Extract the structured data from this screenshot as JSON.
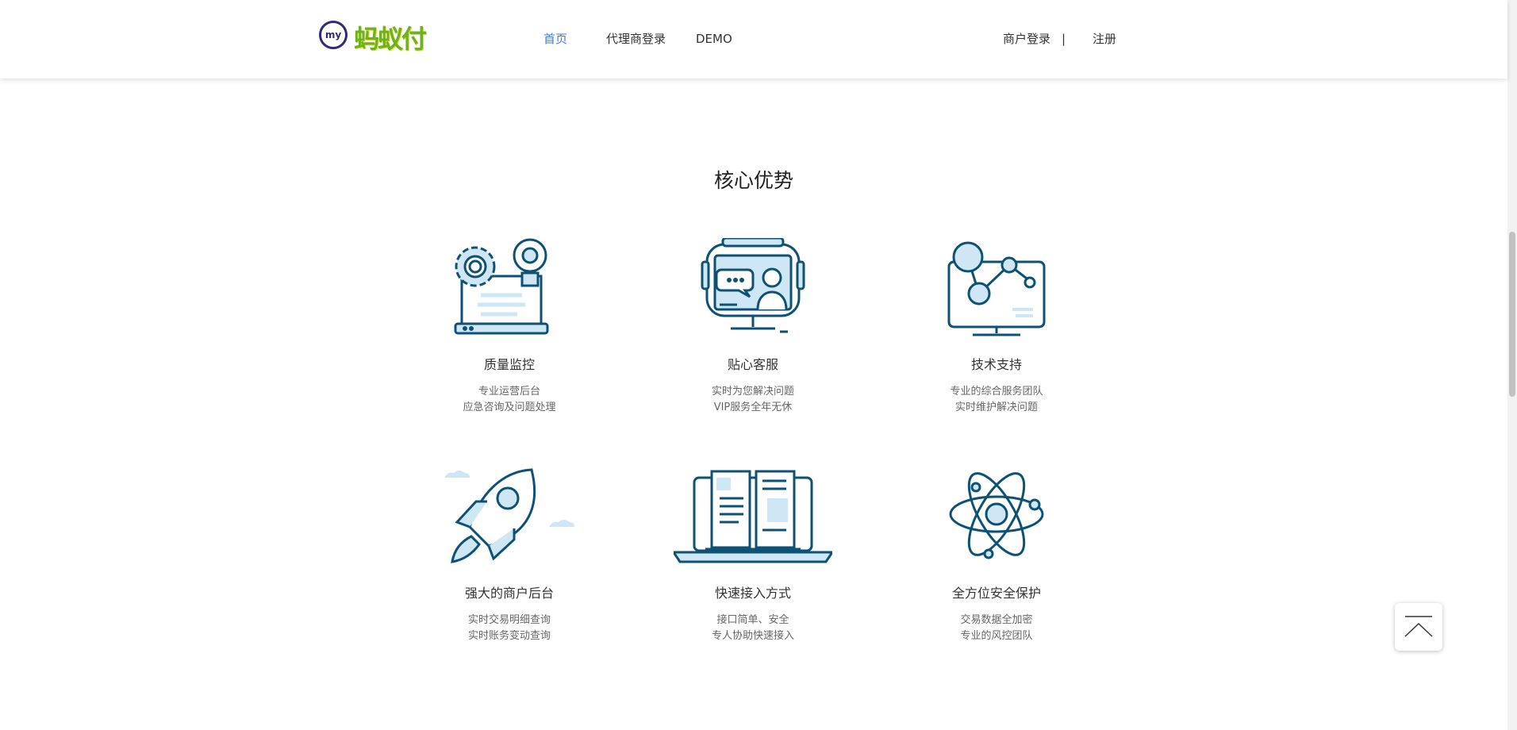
{
  "header": {
    "logo_badge": "my",
    "logo_text": "蚂蚁付",
    "nav": {
      "home": "首页",
      "agent_login": "代理商登录",
      "demo": "DEMO",
      "merchant_login": "商户登录",
      "separator": "|",
      "register": "注册"
    },
    "active_color": "#3b7de0"
  },
  "section": {
    "title": "核心优势",
    "features": [
      {
        "icon": "gear-bulb-laptop-icon",
        "title": "质量监控",
        "line1": "专业运营后台",
        "line2": "应急咨询及问题处理"
      },
      {
        "icon": "video-support-monitor-icon",
        "title": "贴心客服",
        "line1": "实时为您解决问题",
        "line2": "VIP服务全年无休"
      },
      {
        "icon": "network-monitor-icon",
        "title": "技术支持",
        "line1": "专业的综合服务团队",
        "line2": "实时维护解决问题"
      },
      {
        "icon": "rocket-icon",
        "title": "强大的商户后台",
        "line1": "实时交易明细查询",
        "line2": "实时账务变动查询"
      },
      {
        "icon": "book-laptop-icon",
        "title": "快速接入方式",
        "line1": "接口简单、安全",
        "line2": "专人协助快速接入"
      },
      {
        "icon": "atom-icon",
        "title": "全方位安全保护",
        "line1": "交易数据全加密",
        "line2": "专业的风控团队"
      }
    ]
  },
  "colors": {
    "icon_stroke": "#0d5275",
    "icon_fill": "#cfe6f5"
  }
}
